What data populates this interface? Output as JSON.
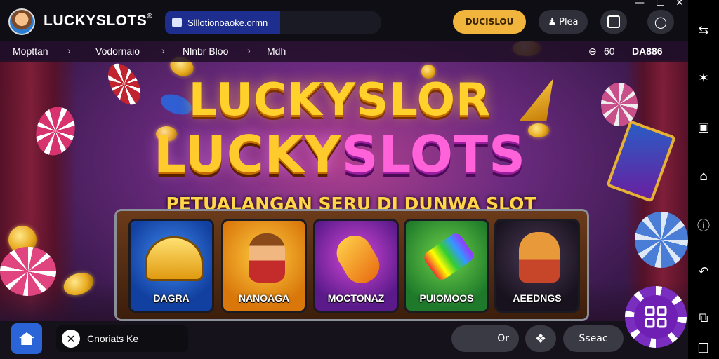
{
  "app": {
    "brand": "LUCKYSLOTS",
    "brand_mark": "®"
  },
  "address": {
    "url": "Slllotionoaoke.ormn"
  },
  "header": {
    "login_label": "DUCISLOU",
    "play_label": "Plea",
    "play_icon": "person-icon",
    "icons": [
      "scan-icon",
      "lightbulb-icon"
    ]
  },
  "breadcrumb": {
    "items": [
      "Mopttan",
      "Vodornaio",
      "Nlnbr Bloo",
      "Mdh"
    ],
    "right_status": "60",
    "right_code": "DA886"
  },
  "hero": {
    "title_line1": "LUCKYSLOR",
    "title_line2_a": "LUCKY",
    "title_line2_b": "SLOTS",
    "subtitle": "PETUALANGAN SERU DI DUNWA SLOT"
  },
  "games": [
    {
      "label": "DAGRA",
      "color": "#1f58c9"
    },
    {
      "label": "NANOAGA",
      "color": "#f0a41d"
    },
    {
      "label": "MOCTONAZ",
      "color": "#9b2fb9"
    },
    {
      "label": "PUIOMOOS",
      "color": "#3aa845"
    },
    {
      "label": "AEEDNGS",
      "color": "#2a2430"
    }
  ],
  "bottom": {
    "app_chip_label": "Cnoriats Ke",
    "search_label": "Or",
    "shoc_label": "Sseac"
  },
  "sidebar": {
    "icons": [
      "translate-icon",
      "settings-icon",
      "window-icon",
      "home-icon",
      "info-icon",
      "back-icon",
      "share-icon",
      "copy-icon"
    ]
  },
  "colors": {
    "accent": "#f1b43d",
    "url_bg": "#1d2e8f",
    "chip": "#6f1fb3"
  }
}
